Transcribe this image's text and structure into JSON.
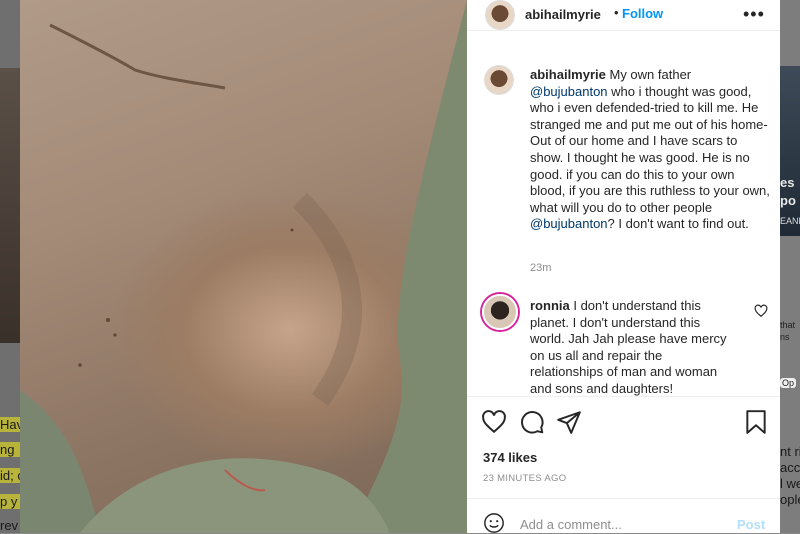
{
  "background": {
    "left_fragments": [
      "Hav",
      "ng",
      "id; c",
      "p y",
      "rev"
    ],
    "right_fragments": [
      "es",
      "po",
      "EANE",
      "that",
      "ns",
      "Op",
      "nt ri",
      "acc",
      "l we",
      "ople"
    ]
  },
  "post": {
    "username": "abihailmyrie",
    "follow_label": "Follow",
    "more_label": "•••",
    "caption": {
      "username": "abihailmyrie",
      "text_1": " My own father ",
      "mention_1": "@bujubanton",
      "text_2": " who i thought was good, who i even defended-tried to kill me. He stranged me and put me out of his home- Out of our home and I have scars to show. I thought he was good. He is no good. if you can do this to your own blood, if you are this ruthless to your own, what will you do to other people ",
      "mention_2": "@bujubanton",
      "text_3": "? I don't want to find out.",
      "time": "23m"
    },
    "comments": [
      {
        "username": "ronnia",
        "text": " I don't understand this planet. I don't understand this world. Jah Jah please have mercy on us all and repair the relationships of man and woman and sons and daughters!"
      }
    ],
    "likes": "374 likes",
    "time_ago": "23 MINUTES AGO",
    "add_comment_placeholder": "Add a comment...",
    "post_label": "Post"
  }
}
